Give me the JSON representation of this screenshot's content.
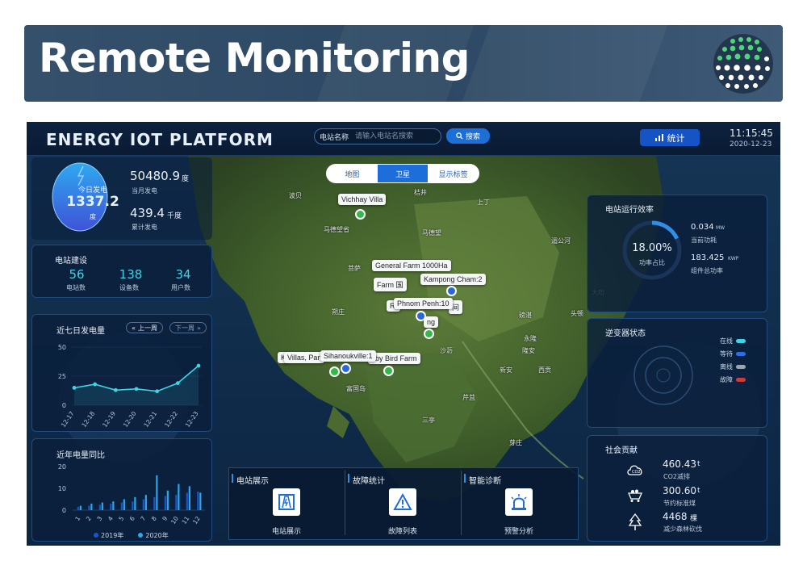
{
  "banner": {
    "title": "Remote Monitoring"
  },
  "app": {
    "title": "ENERGY IOT PLATFORM",
    "search": {
      "label": "电站名称",
      "placeholder": "请输入电站名搜索",
      "button": "搜索"
    },
    "stats_button": "统计",
    "clock": {
      "time": "11:15:45",
      "date": "2020-12-23"
    }
  },
  "generation": {
    "today_label": "今日发电",
    "today_value": "1337.2",
    "today_unit": "度",
    "month_value": "50480.9",
    "month_unit": "度",
    "month_label": "当月发电",
    "total_value": "439.4",
    "total_unit": "千度",
    "total_label": "累计发电"
  },
  "construction": {
    "title": "电站建设",
    "stats": [
      {
        "value": "56",
        "label": "电站数"
      },
      {
        "value": "138",
        "label": "设备数"
      },
      {
        "value": "34",
        "label": "用户数"
      }
    ]
  },
  "weekly": {
    "title": "近七日发电量",
    "prev": "上一周",
    "next": "下一周"
  },
  "yearly": {
    "title": "近年电量同比",
    "legend": [
      "2019年",
      "2020年"
    ]
  },
  "chart_data": [
    {
      "type": "line",
      "title": "近七日发电量",
      "x": [
        "12-17",
        "12-18",
        "12-19",
        "12-20",
        "12-21",
        "12-22",
        "12-23"
      ],
      "series": [
        {
          "values": [
            15,
            18,
            13,
            14,
            12,
            19,
            34
          ]
        }
      ],
      "ylim": [
        0,
        50
      ],
      "yticks": [
        0,
        25,
        50
      ],
      "color": "#3fd3e6"
    },
    {
      "type": "bar",
      "title": "近年电量同比",
      "categories": [
        "1",
        "2",
        "3",
        "4",
        "5",
        "6",
        "7",
        "8",
        "9",
        "10",
        "11",
        "12"
      ],
      "series": [
        {
          "name": "2019年",
          "values": [
            1.5,
            2,
            2.5,
            3,
            3.5,
            4,
            5,
            6,
            6.5,
            7,
            8,
            8.5
          ],
          "color": "#1a56c8"
        },
        {
          "name": "2020年",
          "values": [
            2,
            3,
            3.5,
            4,
            5,
            6,
            7,
            16,
            9,
            12,
            11,
            8
          ],
          "color": "#2aa8e8"
        }
      ],
      "ylim": [
        0,
        20
      ],
      "yticks": [
        0,
        10,
        20
      ]
    }
  ],
  "map": {
    "tabs": [
      "地图",
      "卫星",
      "显示标签"
    ],
    "active_tab": "卫星",
    "markers": [
      {
        "label": "Vichhay Villa"
      },
      {
        "label": "General Farm 1000Ha"
      },
      {
        "label": "Farm 国"
      },
      {
        "label": "Kampong Cham:2"
      },
      {
        "label": "Phnom Penh:10"
      },
      {
        "label": "Villas, Pan"
      },
      {
        "label": "Sihanoukville:1"
      },
      {
        "label": "aby Bird Farm"
      },
      {
        "label": "Ri"
      },
      {
        "label": "ng"
      },
      {
        "label": "间"
      },
      {
        "label": "K"
      }
    ],
    "places": [
      "马德望",
      "菩萨",
      "磅湛",
      "富国岛",
      "芹苴",
      "新安",
      "头顿",
      "隆安",
      "沙沥",
      "三亭",
      "西贡",
      "湄公河",
      "桔井",
      "上丁",
      "波贝",
      "马德望省",
      "永隆",
      "朔庄",
      "芽庄",
      "大叻"
    ]
  },
  "efficiency": {
    "title": "电站运行效率",
    "percent": "18.00%",
    "percent_value": 18,
    "percent_label": "功率占比",
    "power_value": "0.034",
    "power_unit": "MW",
    "power_label": "当前功耗",
    "capacity_value": "183.425",
    "capacity_unit": "KWP",
    "capacity_label": "组件总功率"
  },
  "inverter": {
    "title": "逆变器状态",
    "legend": [
      {
        "label": "在线",
        "color": "#3fd3e6"
      },
      {
        "label": "等待",
        "color": "#2f6ee0"
      },
      {
        "label": "离线",
        "color": "#9aa4b0"
      },
      {
        "label": "故障",
        "color": "#d23a3a"
      }
    ]
  },
  "social": {
    "title": "社会贡献",
    "items": [
      {
        "value": "460.43",
        "unit": "t",
        "label": "CO2减排",
        "icon": "co2-cloud-icon"
      },
      {
        "value": "300.60",
        "unit": "t",
        "label": "节约标准煤",
        "icon": "coal-cart-icon"
      },
      {
        "value": "4468",
        "unit": "棵",
        "label": "减少森林砍伐",
        "icon": "tree-icon"
      }
    ]
  },
  "bottom_cards": [
    {
      "title": "电站展示",
      "label": "电站展示",
      "icon": "station-display-icon"
    },
    {
      "title": "故障统计",
      "label": "故障列表",
      "icon": "warning-icon"
    },
    {
      "title": "智能诊断",
      "label": "预警分析",
      "icon": "alarm-light-icon"
    }
  ]
}
